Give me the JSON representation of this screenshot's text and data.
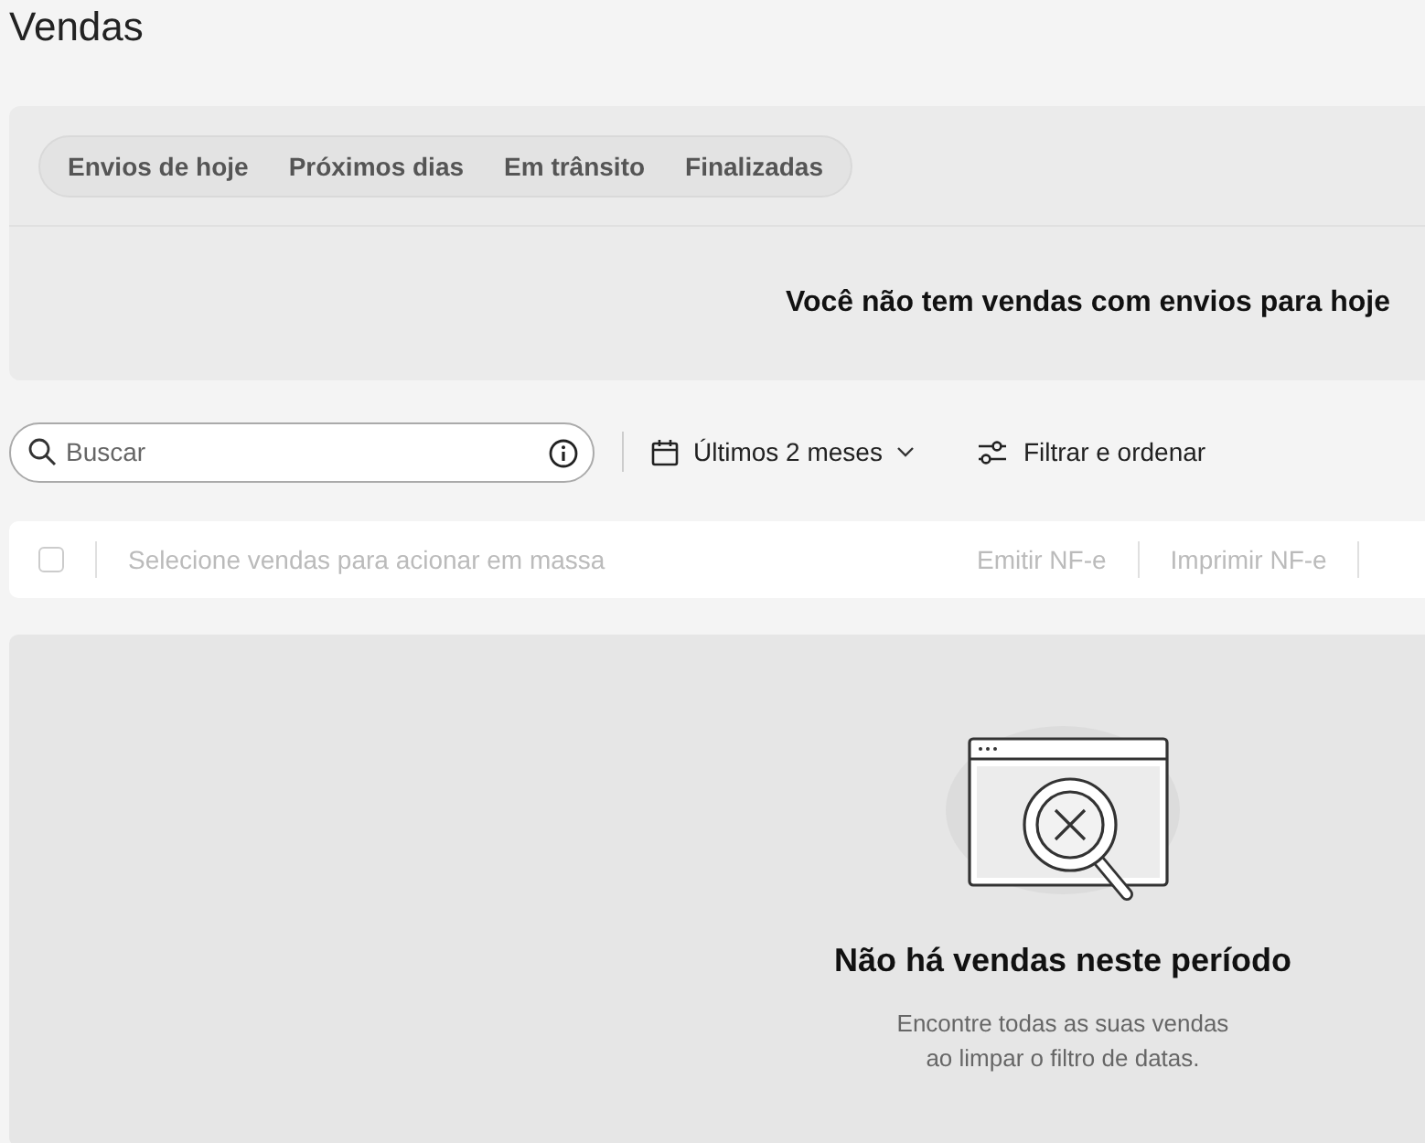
{
  "page": {
    "title": "Vendas"
  },
  "tabs": [
    {
      "label": "Envios de hoje",
      "selected": false
    },
    {
      "label": "Próximos dias",
      "selected": false
    },
    {
      "label": "Em trânsito",
      "selected": false
    },
    {
      "label": "Finalizadas",
      "selected": false
    }
  ],
  "shipments_message": "Você não tem vendas com envios para hoje",
  "search": {
    "placeholder": "Buscar"
  },
  "date_filter": "Últimos 2 meses",
  "filter_button": "Filtrar e ordenar",
  "bulk_bar": {
    "checked": false,
    "hint": "Selecione vendas para acionar em massa",
    "actions": [
      "Emitir NF-e",
      "Imprimir NF-e"
    ]
  },
  "empty_state": {
    "title": "Não há vendas neste período",
    "text": "Encontre todas as suas vendas ao limpar o filtro de datas."
  }
}
